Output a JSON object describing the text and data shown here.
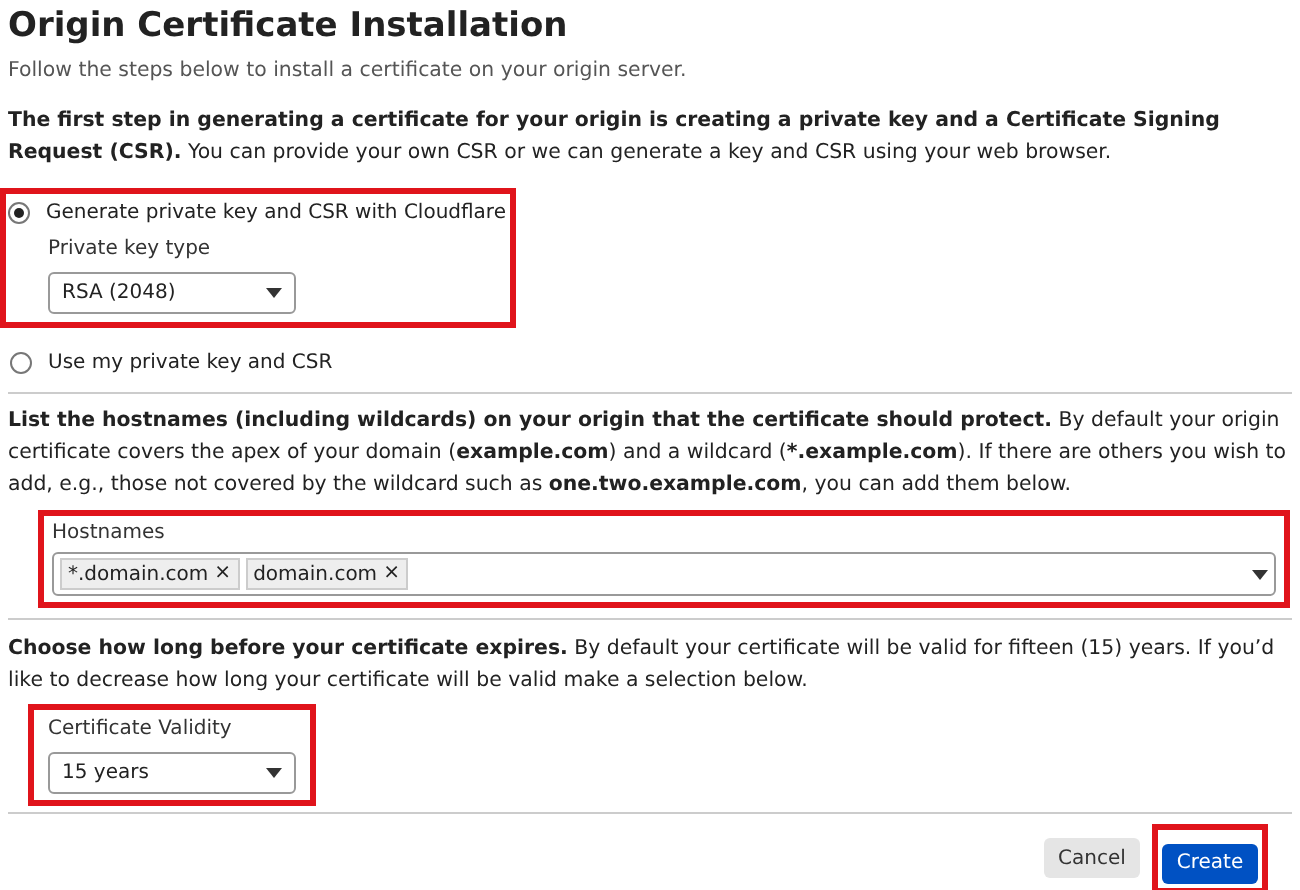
{
  "title": "Origin Certificate Installation",
  "subtitle": "Follow the steps below to install a certificate on your origin server.",
  "intro": "**The first step in generating a certificate for your origin is creating a private key and a Certificate Signing Request (CSR).** You can provide your own CSR or we can generate a key and CSR using your web browser.",
  "key_options": [
    {
      "label": "Generate private key and CSR with Cloudflare",
      "selected": true,
      "field": {
        "label": "Private key type",
        "value": "RSA (2048)"
      }
    },
    {
      "label": "Use my private key and CSR",
      "selected": false
    }
  ],
  "hostnames_text": "**List the hostnames (including wildcards) on your origin that the certificate should protect.** By default your origin certificate covers the apex of your domain (**example.com**) and a wildcard (***.example.com**). If there are others you wish to add, e.g., those not covered by the wildcard such as **one.two.example.com**, you can add them below.",
  "hostnames": {
    "label": "Hostnames",
    "tags": [
      {
        "text": "*.domain.com",
        "remove": "×"
      },
      {
        "text": "domain.com",
        "remove": "×"
      }
    ]
  },
  "validity_text": "**Choose how long before your certificate expires.** By default your certificate will be valid for fifteen (15) years. If you’d like to decrease how long your certificate will be valid make a selection below.",
  "validity": {
    "label": "Certificate Validity",
    "value": "15 years"
  },
  "buttons": [
    {
      "label": "Cancel",
      "kind": "secondary"
    },
    {
      "label": "Create",
      "kind": "primary"
    }
  ]
}
